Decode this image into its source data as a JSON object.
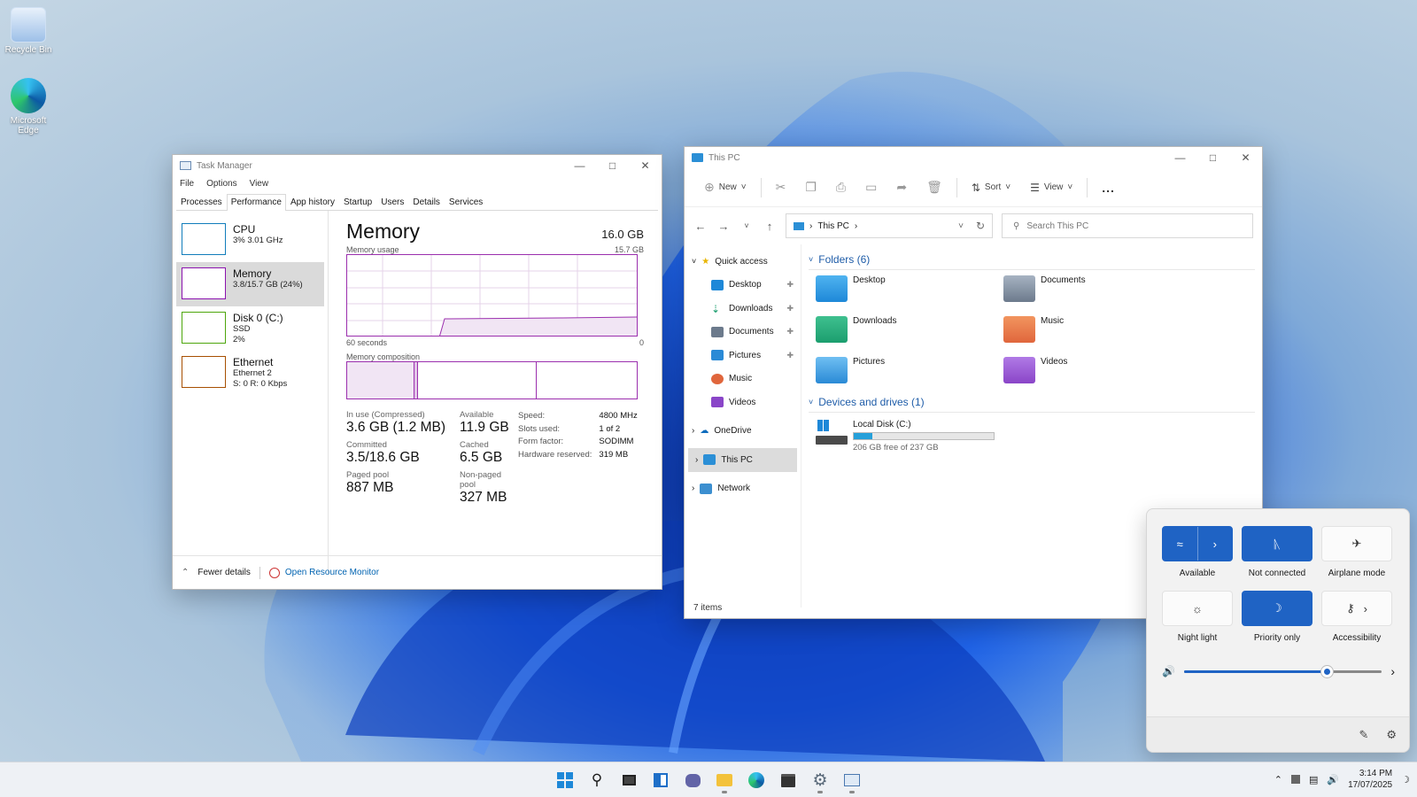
{
  "desktop": {
    "icons": [
      {
        "label": "Recycle Bin"
      },
      {
        "label": "Microsoft Edge"
      }
    ]
  },
  "task_manager": {
    "title": "Task Manager",
    "menu": [
      "File",
      "Options",
      "View"
    ],
    "tabs": [
      "Processes",
      "Performance",
      "App history",
      "Startup",
      "Users",
      "Details",
      "Services"
    ],
    "active_tab": "Performance",
    "resources": [
      {
        "name": "CPU",
        "line1": "3% 3.01 GHz",
        "line2": "",
        "line3": "",
        "color": "#117dbb"
      },
      {
        "name": "Memory",
        "line1": "3.8/15.7 GB (24%)",
        "line2": "",
        "line3": "",
        "color": "#8b12ae"
      },
      {
        "name": "Disk 0 (C:)",
        "line1": "SSD",
        "line2": "2%",
        "line3": "",
        "color": "#4da60c"
      },
      {
        "name": "Ethernet",
        "line1": "Ethernet 2",
        "line2": "S: 0 R: 0 Kbps",
        "line3": "",
        "color": "#a74f01"
      }
    ],
    "memory": {
      "heading": "Memory",
      "total": "16.0 GB",
      "usage_label": "Memory usage",
      "usage_max": "15.7 GB",
      "time_left": "60 seconds",
      "time_right": "0",
      "composition_label": "Memory composition",
      "in_use_label": "In use (Compressed)",
      "in_use": "3.6 GB (1.2 MB)",
      "available_label": "Available",
      "available": "11.9 GB",
      "committed_label": "Committed",
      "committed": "3.5/18.6 GB",
      "cached_label": "Cached",
      "cached": "6.5 GB",
      "paged_label": "Paged pool",
      "paged": "887 MB",
      "nonpaged_label": "Non-paged pool",
      "nonpaged": "327 MB",
      "specs": [
        {
          "k": "Speed:",
          "v": "4800 MHz"
        },
        {
          "k": "Slots used:",
          "v": "1 of 2"
        },
        {
          "k": "Form factor:",
          "v": "SODIMM"
        },
        {
          "k": "Hardware reserved:",
          "v": "319 MB"
        }
      ]
    },
    "footer": {
      "fewer": "Fewer details",
      "monitor": "Open Resource Monitor"
    }
  },
  "explorer": {
    "title": "This PC",
    "commands": {
      "new": "New",
      "sort": "Sort",
      "view": "View",
      "more": "..."
    },
    "address": "This PC",
    "search_placeholder": "Search This PC",
    "nav": {
      "quick_access": "Quick access",
      "items": [
        "Desktop",
        "Downloads",
        "Documents",
        "Pictures",
        "Music",
        "Videos"
      ],
      "onedrive": "OneDrive",
      "this_pc": "This PC",
      "network": "Network"
    },
    "folders_header": "Folders (6)",
    "folders": [
      {
        "name": "Desktop",
        "color": "#1e88d8"
      },
      {
        "name": "Documents",
        "color": "#6c7a8c"
      },
      {
        "name": "Downloads",
        "color": "#1b9e6e"
      },
      {
        "name": "Music",
        "color": "#e0663c"
      },
      {
        "name": "Pictures",
        "color": "#2a8ad6"
      },
      {
        "name": "Videos",
        "color": "#8a45c8"
      }
    ],
    "drives_header": "Devices and drives (1)",
    "drive": {
      "name": "Local Disk (C:)",
      "free": "206 GB free of 237 GB",
      "used_fraction": 0.13
    },
    "status": "7 items"
  },
  "quick_settings": {
    "tiles": [
      {
        "label": "Available",
        "icon": "wifi-icon",
        "on": true
      },
      {
        "label": "Not connected",
        "icon": "bluetooth-icon",
        "on": true
      },
      {
        "label": "Airplane mode",
        "icon": "airplane-icon",
        "on": false
      },
      {
        "label": "Night light",
        "icon": "sun-icon",
        "on": false
      },
      {
        "label": "Priority only",
        "icon": "moon-icon",
        "on": true
      },
      {
        "label": "Accessibility",
        "icon": "accessibility-icon",
        "on": false
      }
    ],
    "volume_fraction": 0.72
  },
  "taskbar": {
    "time": "3:14 PM",
    "date": "17/07/2025"
  }
}
